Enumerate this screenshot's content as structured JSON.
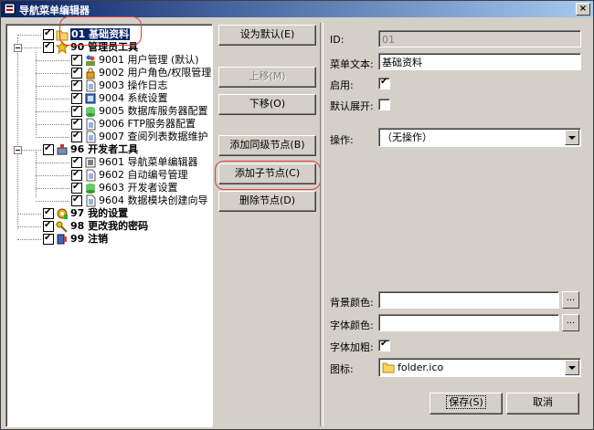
{
  "window": {
    "title": "导航菜单编辑器",
    "close_label": "×"
  },
  "tree": [
    {
      "label": "01 基础资料",
      "bold": true,
      "selected": true,
      "level": 0,
      "icon": "folder-icon"
    },
    {
      "label": "90 管理员工具",
      "bold": true,
      "level": 0,
      "icon": "star-icon"
    },
    {
      "label": "9001 用户管理 (默认)",
      "level": 1,
      "icon": "users-icon"
    },
    {
      "label": "9002 用户角色/权限管理",
      "level": 1,
      "icon": "lock-icon"
    },
    {
      "label": "9003 操作日志",
      "level": 1,
      "icon": "document-icon"
    },
    {
      "label": "9004 系统设置",
      "level": 1,
      "icon": "settings-icon"
    },
    {
      "label": "9005 数据库服务器配置",
      "level": 1,
      "icon": "database-icon"
    },
    {
      "label": "9006 FTP服务器配置",
      "level": 1,
      "icon": "document-icon"
    },
    {
      "label": "9007 查阅列表数据维护",
      "level": 1,
      "icon": "document-icon"
    },
    {
      "label": "96 开发者工具",
      "bold": true,
      "level": 0,
      "icon": "developer-icon"
    },
    {
      "label": "9601 导航菜单编辑器",
      "level": 1,
      "icon": "menu-editor-icon"
    },
    {
      "label": "9602 自动编号管理",
      "level": 1,
      "icon": "document-icon"
    },
    {
      "label": "9603 开发者设置",
      "level": 1,
      "icon": "database-icon"
    },
    {
      "label": "9604 数据模块创建向导",
      "level": 1,
      "icon": "document-icon"
    },
    {
      "label": "97 我的设置",
      "bold": true,
      "level": 0,
      "icon": "gear-icon"
    },
    {
      "label": "98 更改我的密码",
      "bold": true,
      "level": 0,
      "icon": "key-icon"
    },
    {
      "label": "99 注销",
      "bold": true,
      "level": 0,
      "icon": "logout-icon"
    }
  ],
  "buttons": {
    "set_default": "设为默认(E)",
    "move_up": "上移(M)",
    "move_down": "下移(O)",
    "add_sibling": "添加同级节点(B)",
    "add_child": "添加子节点(C)",
    "delete_node": "删除节点(D)",
    "save": "保存(S)",
    "cancel": "取消"
  },
  "form": {
    "id_label": "ID:",
    "id_value": "01",
    "text_label": "菜单文本:",
    "text_value": "基础资料",
    "enabled_label": "启用:",
    "enabled": true,
    "expand_label": "默认展开:",
    "expand": false,
    "action_label": "操作:",
    "action_value": "（无操作）",
    "bg_color_label": "背景颜色:",
    "bg_color_value": "",
    "font_color_label": "字体颜色:",
    "font_color_value": "",
    "bold_label": "字体加粗:",
    "bold": true,
    "icon_label": "图标:",
    "icon_value": "folder.ico",
    "ellipsis": "..."
  },
  "colors": {
    "titlebar": "#0a246a",
    "highlight": "#e03c3c",
    "selection": "#0a246a"
  }
}
